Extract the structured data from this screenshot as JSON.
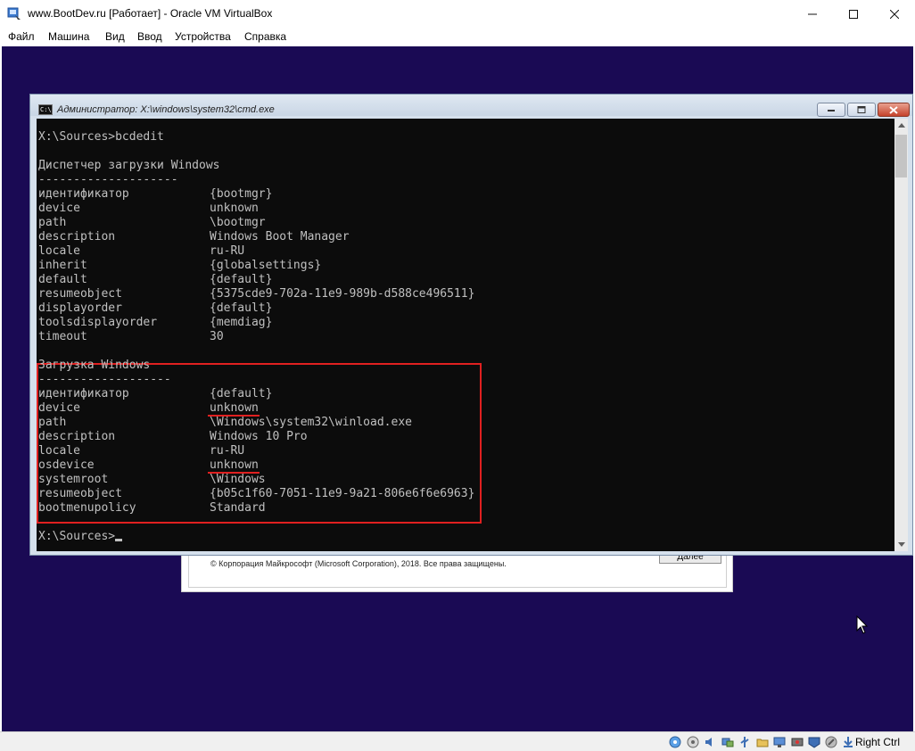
{
  "window": {
    "title": "www.BootDev.ru [Работает] - Oracle VM VirtualBox"
  },
  "menu": [
    {
      "label": "Файл"
    },
    {
      "label": "Машина"
    },
    {
      "label": "Вид"
    },
    {
      "label": "Ввод"
    },
    {
      "label": "Устройства"
    },
    {
      "label": "Справка"
    }
  ],
  "cmd": {
    "title": "Администратор: X:\\windows\\system32\\cmd.exe",
    "command_line": "X:\\Sources>bcdedit",
    "bootmgr_header": "Диспетчер загрузки Windows",
    "bootmgr_separator": "--------------------",
    "bootmgr_entries": [
      {
        "key": "идентификатор",
        "value": "{bootmgr}"
      },
      {
        "key": "device",
        "value": "unknown"
      },
      {
        "key": "path",
        "value": "\\bootmgr"
      },
      {
        "key": "description",
        "value": "Windows Boot Manager"
      },
      {
        "key": "locale",
        "value": "ru-RU"
      },
      {
        "key": "inherit",
        "value": "{globalsettings}"
      },
      {
        "key": "default",
        "value": "{default}"
      },
      {
        "key": "resumeobject",
        "value": "{5375cde9-702a-11e9-989b-d588ce496511}"
      },
      {
        "key": "displayorder",
        "value": "{default}"
      },
      {
        "key": "toolsdisplayorder",
        "value": "{memdiag}"
      },
      {
        "key": "timeout",
        "value": "30"
      }
    ],
    "loader_header": "Загрузка Windows",
    "loader_separator": "-------------------",
    "loader_entries": [
      {
        "key": "идентификатор",
        "value": "{default}"
      },
      {
        "key": "device",
        "value": "unknown"
      },
      {
        "key": "path",
        "value": "\\Windows\\system32\\winload.exe"
      },
      {
        "key": "description",
        "value": "Windows 10 Pro"
      },
      {
        "key": "locale",
        "value": "ru-RU"
      },
      {
        "key": "osdevice",
        "value": "unknown"
      },
      {
        "key": "systemroot",
        "value": "\\Windows"
      },
      {
        "key": "resumeobject",
        "value": "{b05c1f60-7051-11e9-9a21-806e6f6e6963}"
      },
      {
        "key": "bootmenupolicy",
        "value": "Standard"
      }
    ],
    "prompt": "X:\\Sources>"
  },
  "setup": {
    "copyright": "© Корпорация Майкрософт (Microsoft Corporation), 2018. Все права защищены.",
    "next_button": "Далее"
  },
  "statusbar": {
    "host_key": "Right Ctrl",
    "icons": [
      "hard-disk-icon",
      "optical-drive-icon",
      "audio-icon",
      "network-icon",
      "usb-icon",
      "shared-folders-icon",
      "display-icon",
      "video-capture-icon",
      "virtualization-icon",
      "mouse-integration-icon",
      "keyboard-capture-icon"
    ]
  },
  "colors": {
    "vm_background": "#1a0a54",
    "console_background": "#0c0c0c",
    "console_text": "#c0c0c0",
    "highlight": "#e02020"
  }
}
